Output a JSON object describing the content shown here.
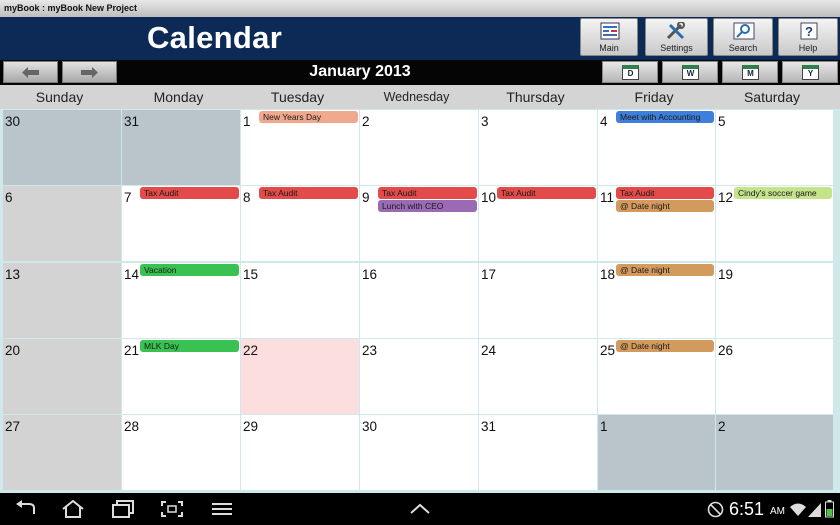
{
  "window": {
    "title": "myBook : myBook New Project"
  },
  "header": {
    "title": "Calendar",
    "buttons": [
      {
        "label": "Main",
        "icon": "main-icon"
      },
      {
        "label": "Settings",
        "icon": "settings-icon"
      },
      {
        "label": "Search",
        "icon": "search-icon"
      },
      {
        "label": "Help",
        "icon": "help-icon"
      }
    ]
  },
  "nav": {
    "month": "January 2013",
    "views": [
      "D",
      "W",
      "M",
      "Y"
    ]
  },
  "weekdays": [
    "Sunday",
    "Monday",
    "Tuesday",
    "Wednesday",
    "Thursday",
    "Friday",
    "Saturday"
  ],
  "weeks": [
    [
      {
        "day": "30",
        "type": "other"
      },
      {
        "day": "31",
        "type": "other"
      },
      {
        "day": "1"
      },
      {
        "day": "2"
      },
      {
        "day": "3"
      },
      {
        "day": "4"
      },
      {
        "day": "5"
      }
    ],
    [
      {
        "day": "6",
        "type": "grey"
      },
      {
        "day": "7"
      },
      {
        "day": "8"
      },
      {
        "day": "9"
      },
      {
        "day": "10"
      },
      {
        "day": "11"
      },
      {
        "day": "12"
      }
    ],
    [
      {
        "day": "13",
        "type": "grey"
      },
      {
        "day": "14"
      },
      {
        "day": "15"
      },
      {
        "day": "16"
      },
      {
        "day": "17"
      },
      {
        "day": "18"
      },
      {
        "day": "19"
      }
    ],
    [
      {
        "day": "20",
        "type": "grey"
      },
      {
        "day": "21"
      },
      {
        "day": "22",
        "type": "today"
      },
      {
        "day": "23"
      },
      {
        "day": "24"
      },
      {
        "day": "25"
      },
      {
        "day": "26"
      }
    ],
    [
      {
        "day": "27",
        "type": "grey"
      },
      {
        "day": "28"
      },
      {
        "day": "29"
      },
      {
        "day": "30"
      },
      {
        "day": "31"
      },
      {
        "day": "1",
        "type": "other"
      },
      {
        "day": "2",
        "type": "other"
      }
    ]
  ],
  "events": [
    {
      "week": 0,
      "dow": 2,
      "slot": 0,
      "label": "New Years Day",
      "color": "#f0a98e"
    },
    {
      "week": 0,
      "dow": 5,
      "slot": 0,
      "label": "Meet with Accounting",
      "color": "#3f7fdc"
    },
    {
      "week": 1,
      "dow": 1,
      "slot": 0,
      "label": "Tax Audit",
      "color": "#e34a4a"
    },
    {
      "week": 1,
      "dow": 2,
      "slot": 0,
      "label": "Tax Audit",
      "color": "#e34a4a"
    },
    {
      "week": 1,
      "dow": 3,
      "slot": 0,
      "label": "Tax Audit",
      "color": "#e34a4a"
    },
    {
      "week": 1,
      "dow": 3,
      "slot": 1,
      "label": "Lunch with CEO",
      "color": "#9a6bb4"
    },
    {
      "week": 1,
      "dow": 4,
      "slot": 0,
      "label": "Tax Audit",
      "color": "#e34a4a"
    },
    {
      "week": 1,
      "dow": 5,
      "slot": 0,
      "label": "Tax Audit",
      "color": "#e34a4a"
    },
    {
      "week": 1,
      "dow": 5,
      "slot": 1,
      "label": "@ Date night",
      "color": "#d39a5e"
    },
    {
      "week": 1,
      "dow": 6,
      "slot": 0,
      "label": "Cindy's soccer game",
      "color": "#c4e38a"
    },
    {
      "week": 2,
      "dow": 1,
      "slot": 0,
      "label": "Vacation",
      "color": "#39c252"
    },
    {
      "week": 2,
      "dow": 5,
      "slot": 0,
      "label": "@ Date night",
      "color": "#d39a5e"
    },
    {
      "week": 3,
      "dow": 1,
      "slot": 0,
      "label": "MLK Day",
      "color": "#39c252"
    },
    {
      "week": 3,
      "dow": 5,
      "slot": 0,
      "label": "@ Date night",
      "color": "#d39a5e"
    }
  ],
  "status": {
    "time": "6:51",
    "ampm": "AM"
  }
}
